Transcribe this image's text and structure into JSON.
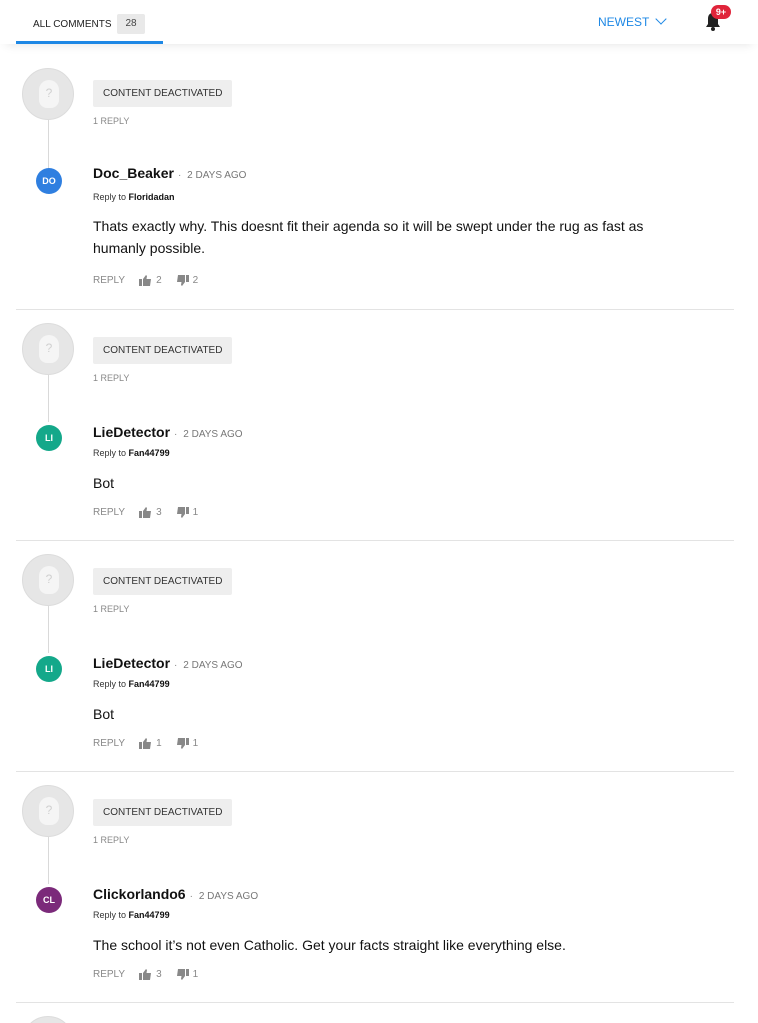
{
  "header": {
    "tab_label": "ALL COMMENTS",
    "count": "28",
    "sort_label": "NEWEST",
    "notif_badge": "9+"
  },
  "deactivated_label": "CONTENT DEACTIVATED",
  "reply_count_label": "1 REPLY",
  "reply_label": "REPLY",
  "reply_to_prefix": "Reply to",
  "time_label": "2 DAYS AGO",
  "colors": {
    "accent": "#1e88e5",
    "badge": "#e0243a"
  },
  "threads": [
    {
      "reply": {
        "initials": "DO",
        "avatar_color": "#2f7fe0",
        "author": "Doc_Beaker",
        "reply_to": "Floridadan",
        "text": "Thats exactly why. This doesnt fit their agenda so it will be swept under the rug as fast as humanly possible.",
        "up": "2",
        "down": "2"
      }
    },
    {
      "reply": {
        "initials": "LI",
        "avatar_color": "#14a88a",
        "author": "LieDetector",
        "reply_to": "Fan44799",
        "text": "Bot",
        "up": "3",
        "down": "1"
      }
    },
    {
      "reply": {
        "initials": "LI",
        "avatar_color": "#14a88a",
        "author": "LieDetector",
        "reply_to": "Fan44799",
        "text": "Bot",
        "up": "1",
        "down": "1"
      }
    },
    {
      "reply": {
        "initials": "CL",
        "avatar_color": "#7b2a7a",
        "author": "Clickorlando6",
        "reply_to": "Fan44799",
        "text": "The school it’s not even Catholic. Get your facts straight like everything else.",
        "up": "3",
        "down": "1"
      }
    }
  ]
}
